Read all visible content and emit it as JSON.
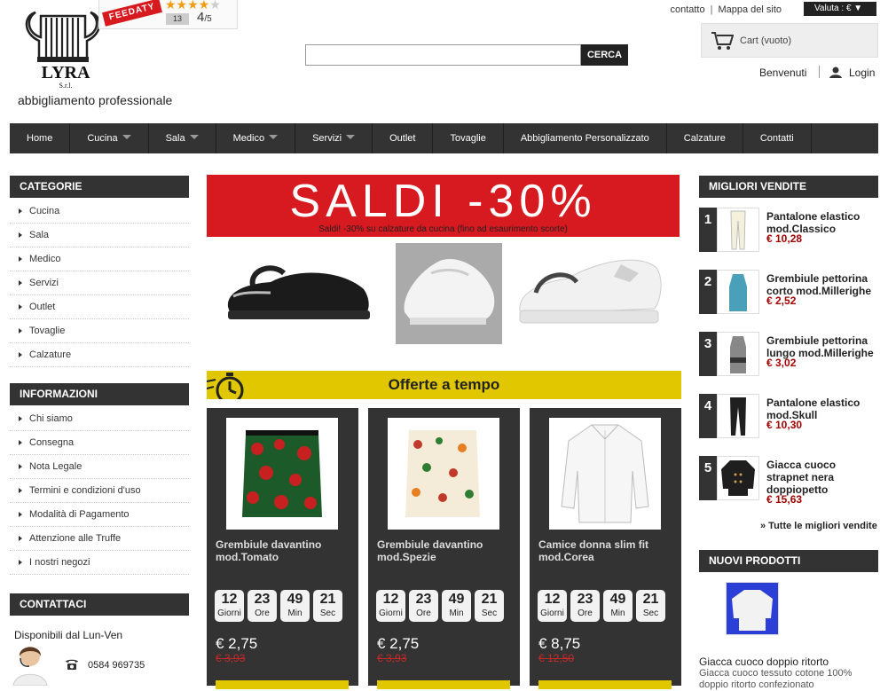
{
  "header": {
    "brand_name": "LYRA",
    "brand_suffix": "S.r.l.",
    "tagline": "abbigliamento professionale",
    "feedaty": {
      "label": "FEEDATY",
      "count": "13",
      "score": "4",
      "score_max": "/5",
      "stars": 4
    },
    "top_links": [
      "contatto",
      "Mappa del sito"
    ],
    "currency": "Valuta : € ▼",
    "search": {
      "placeholder": "",
      "value": "",
      "button": "CERCA"
    },
    "cart": "Cart (vuoto)",
    "welcome": "Benvenuti",
    "login": "Login"
  },
  "nav": [
    {
      "label": "Home",
      "dropdown": false
    },
    {
      "label": "Cucina",
      "dropdown": true
    },
    {
      "label": "Sala",
      "dropdown": true
    },
    {
      "label": "Medico",
      "dropdown": true
    },
    {
      "label": "Servizi",
      "dropdown": true
    },
    {
      "label": "Outlet",
      "dropdown": false
    },
    {
      "label": "Tovaglie",
      "dropdown": false
    },
    {
      "label": "Abbigliamento Personalizzato",
      "dropdown": false
    },
    {
      "label": "Calzature",
      "dropdown": false
    },
    {
      "label": "Contatti",
      "dropdown": false
    }
  ],
  "left": {
    "categories_title": "CATEGORIE",
    "categories": [
      "Cucina",
      "Sala",
      "Medico",
      "Servizi",
      "Outlet",
      "Tovaglie",
      "Calzature"
    ],
    "info_title": "INFORMAZIONI",
    "info": [
      "Chi siamo",
      "Consegna",
      "Nota Legale",
      "Termini e condizioni d'uso",
      "Modalità di Pagamento",
      "Attenzione alle Truffe",
      "I nostri negozi"
    ],
    "contact_title": "CONTATTACI",
    "contact_text": "Disponibili dal Lun-Ven",
    "phone": "0584 969735"
  },
  "banner": {
    "headline": "SALDI -30%",
    "subline": "Saldi! -30% su calzature da cucina (fino ad esaurimento scorte)"
  },
  "offers": {
    "title": "Offerte a tempo",
    "items": [
      {
        "name": "Grembiule davantino mod.Tomato",
        "price": "€ 2,75",
        "old_price": "€ 3,93",
        "days": "12",
        "hours": "23",
        "mins": "49",
        "secs": "21"
      },
      {
        "name": "Grembiule davantino mod.Spezie",
        "price": "€ 2,75",
        "old_price": "€ 3,93",
        "days": "12",
        "hours": "23",
        "mins": "49",
        "secs": "21"
      },
      {
        "name": "Camice donna slim fit mod.Corea",
        "price": "€ 8,75",
        "old_price": "€ 12,50",
        "days": "12",
        "hours": "23",
        "mins": "49",
        "secs": "21"
      }
    ],
    "labels": {
      "days": "Giorni",
      "hours": "Ore",
      "mins": "Min",
      "secs": "Sec"
    }
  },
  "best_sellers": {
    "title": "MIGLIORI VENDITE",
    "items": [
      {
        "rank": "1",
        "name": "Pantalone elastico mod.Classico",
        "price": "€ 10,28"
      },
      {
        "rank": "2",
        "name": "Grembiule pettorina corto mod.Millerighe",
        "price": "€ 2,52"
      },
      {
        "rank": "3",
        "name": "Grembiule pettorina lungo mod.Millerighe",
        "price": "€ 3,02"
      },
      {
        "rank": "4",
        "name": "Pantalone elastico mod.Skull",
        "price": "€ 10,30"
      },
      {
        "rank": "5",
        "name": "Giacca cuoco strapnet nera doppiopetto",
        "price": "€ 15,63"
      }
    ],
    "all_link": "» Tutte le migliori vendite"
  },
  "new_products": {
    "title": "NUOVI PRODOTTI",
    "name": "Giacca cuoco doppio ritorto",
    "desc": "Giacca cuoco tessuto cotone 100% doppio ritorto confezionato"
  },
  "colors": {
    "dark": "#333333",
    "accent_red": "#d71920",
    "accent_yellow": "#e1c700",
    "price_red": "#a40000"
  }
}
